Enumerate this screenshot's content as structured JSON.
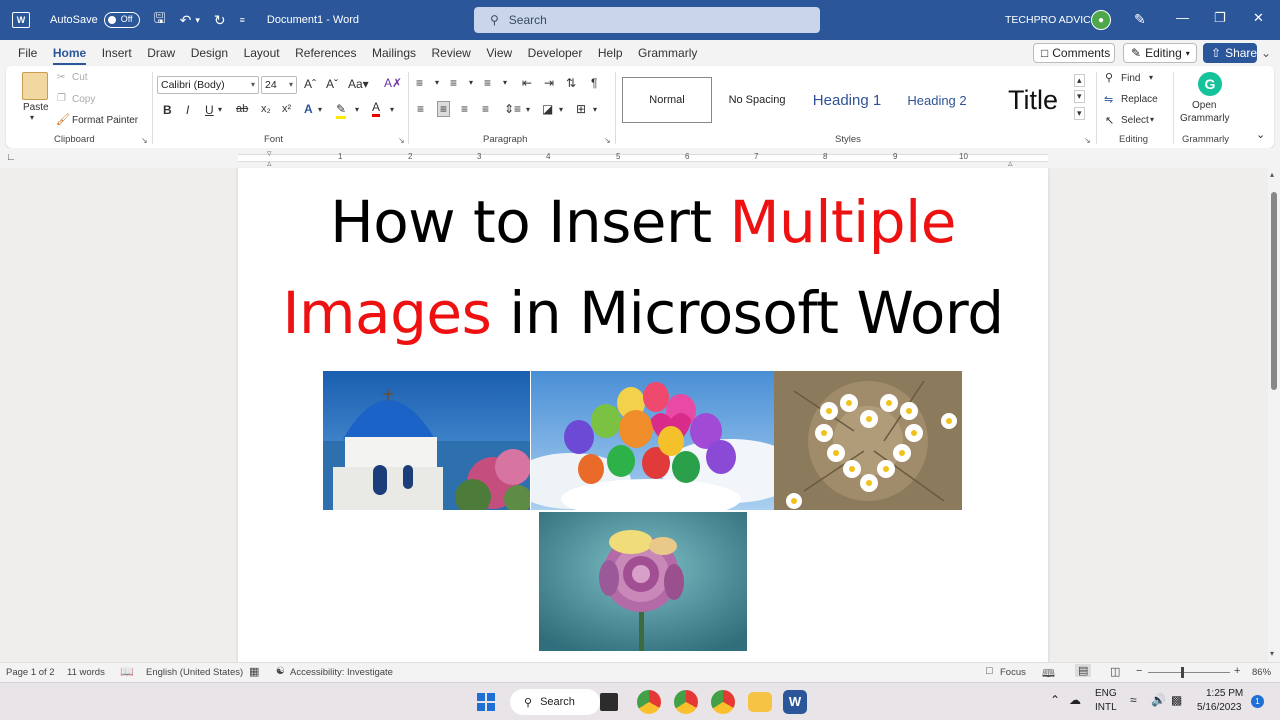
{
  "titlebar": {
    "autosave_label": "AutoSave",
    "autosave_state": "Off",
    "doc_title": "Document1 - Word",
    "search_placeholder": "Search",
    "user_name": "TECHPRO ADVICE"
  },
  "menu": {
    "tabs": [
      "File",
      "Home",
      "Insert",
      "Draw",
      "Design",
      "Layout",
      "References",
      "Mailings",
      "Review",
      "View",
      "Developer",
      "Help",
      "Grammarly"
    ],
    "active_tab": "Home",
    "comments_label": "Comments",
    "editing_label": "Editing",
    "share_label": "Share"
  },
  "ribbon": {
    "clipboard": {
      "paste": "Paste",
      "cut": "Cut",
      "copy": "Copy",
      "format_painter": "Format Painter",
      "label": "Clipboard"
    },
    "font": {
      "name": "Calibri (Body)",
      "size": "24",
      "label": "Font"
    },
    "paragraph": {
      "label": "Paragraph"
    },
    "styles": {
      "items": [
        "Normal",
        "No Spacing",
        "Heading 1",
        "Heading 2",
        "Title"
      ],
      "label": "Styles"
    },
    "editing": {
      "find": "Find",
      "replace": "Replace",
      "select": "Select",
      "label": "Editing"
    },
    "grammarly": {
      "open_line1": "Open",
      "open_line2": "Grammarly",
      "label": "Grammarly"
    }
  },
  "ruler": {
    "marks": [
      "1",
      "2",
      "3",
      "4",
      "5",
      "6",
      "7",
      "8",
      "9",
      "10"
    ]
  },
  "vruler": {
    "marks": [
      "1",
      "2",
      "3",
      "4",
      "5",
      "6"
    ]
  },
  "document": {
    "heading_line1_black": "How to Insert ",
    "heading_line1_red": "Multiple",
    "heading_line2_red": "Images",
    "heading_line2_black": " in Microsoft Word",
    "images": [
      "church-dome-image",
      "balloons-image",
      "daisy-heart-image",
      "rose-image"
    ]
  },
  "statusbar": {
    "page": "Page 1 of 2",
    "words": "11 words",
    "language": "English (United States)",
    "accessibility": "Accessibility: Investigate",
    "focus": "Focus",
    "zoom": "86%"
  },
  "taskbar": {
    "search_label": "Search",
    "lang_line1": "ENG",
    "lang_line2": "INTL",
    "time": "1:25 PM",
    "date": "5/16/2023",
    "notification_count": "1"
  },
  "colors": {
    "word_blue": "#2b579a",
    "heading_red": "#ee1111",
    "grammarly_green": "#15c39a"
  }
}
